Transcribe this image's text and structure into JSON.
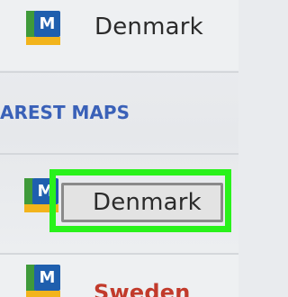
{
  "rows": [
    {
      "label": "Denmark",
      "icon": "app-logo-icon"
    },
    {
      "label": "Denmark",
      "icon": "app-logo-icon"
    },
    {
      "label": "Sweden",
      "icon": "app-logo-icon"
    }
  ],
  "section": {
    "header": "AREST MAPS"
  },
  "app_icon_letter": "M",
  "colors": {
    "highlight": "#29f21b",
    "section_header": "#3a61b8",
    "logo_green": "#3f9a3a",
    "logo_blue": "#1f5fae",
    "logo_yellow": "#f2b41c",
    "partial_row_text": "#c23a2b"
  }
}
